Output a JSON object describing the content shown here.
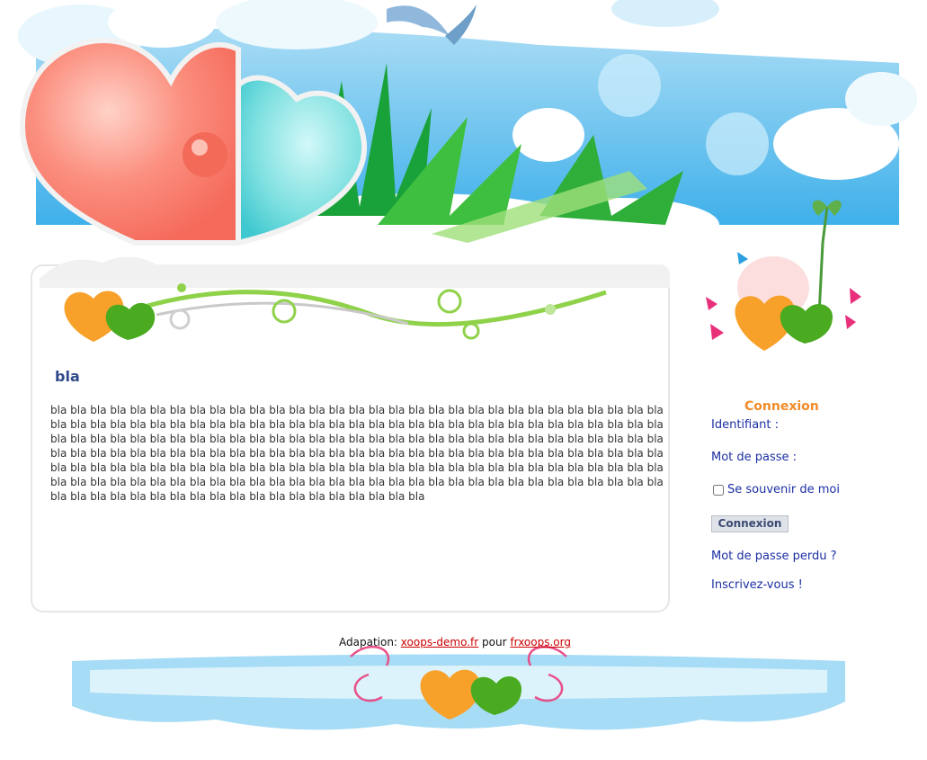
{
  "content": {
    "title": "bla",
    "body": "bla bla bla bla bla bla bla bla bla bla bla bla bla bla bla bla bla bla bla bla bla bla bla bla bla bla bla bla bla bla bla bla bla bla bla bla bla bla bla bla bla bla bla bla bla bla bla bla bla bla bla bla bla bla bla bla bla bla bla bla bla bla bla bla bla bla bla bla bla bla bla bla bla bla bla bla bla bla bla bla bla bla bla bla bla bla bla bla bla bla bla bla bla bla bla bla bla bla bla bla bla bla bla bla bla bla bla bla bla bla bla bla bla bla bla bla bla bla bla bla bla bla bla bla bla bla bla bla bla bla bla bla bla bla bla bla bla bla bla bla bla bla bla bla bla bla bla bla bla bla bla bla bla bla bla bla bla bla bla bla bla bla bla bla bla bla bla bla bla bla bla bla bla bla bla bla bla bla bla bla bla bla bla bla bla bla bla bla bla bla bla bla bla bla bla bla bla bla bla bla bla bla bla bla bla"
  },
  "login": {
    "title": "Connexion",
    "username_label": "Identifiant :",
    "password_label": "Mot de passe :",
    "remember_label": "Se souvenir de moi",
    "submit_label": "Connexion",
    "lost_password": "Mot de passe perdu ?",
    "register": "Inscrivez-vous !"
  },
  "footer": {
    "prefix": "Adapation: ",
    "link1": "xoops-demo.fr",
    "middle": " pour ",
    "link2": "frxoops.org"
  },
  "colors": {
    "title_blue": "#2f4a8a",
    "link_blue": "#1c2fa3",
    "accent_orange": "#f28b28",
    "footer_link_red": "#cc0000"
  }
}
